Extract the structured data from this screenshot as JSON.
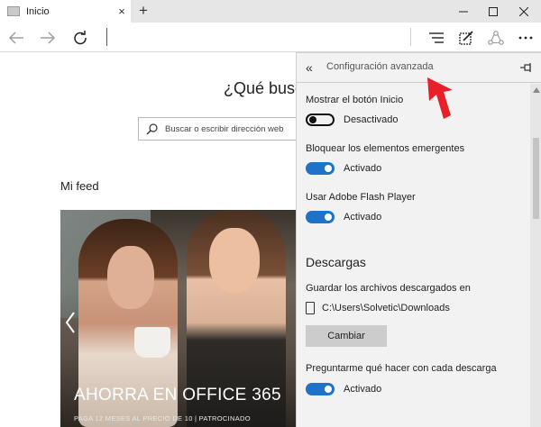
{
  "window": {
    "tab_title": "Inicio",
    "tab_close": "×",
    "new_tab": "+"
  },
  "page": {
    "hero_title": "¿Qué busc",
    "search_placeholder": "Buscar o escribir dirección web",
    "feed_heading": "Mi feed",
    "card_title": "AHORRA EN OFFICE 365",
    "card_subtitle": "PAGA 12 MESES AL PRECIO DE 10 | PATROCINADO"
  },
  "panel": {
    "back_label": "«",
    "title": "Configuración avanzada",
    "settings": [
      {
        "label": "Mostrar el botón Inicio",
        "state": "off",
        "state_label": "Desactivado"
      },
      {
        "label": "Bloquear los elementos emergentes",
        "state": "on",
        "state_label": "Activado"
      },
      {
        "label": "Usar Adobe Flash Player",
        "state": "on",
        "state_label": "Activado"
      }
    ],
    "downloads": {
      "heading": "Descargas",
      "save_label": "Guardar los archivos descargados en",
      "path": "C:\\Users\\Solvetic\\Downloads",
      "change_button": "Cambiar",
      "ask_label": "Preguntarme qué hacer con cada descarga",
      "ask_state": "on",
      "ask_state_label": "Activado"
    }
  },
  "colors": {
    "accent": "#1e73c8",
    "annotation": "#e8202a"
  }
}
